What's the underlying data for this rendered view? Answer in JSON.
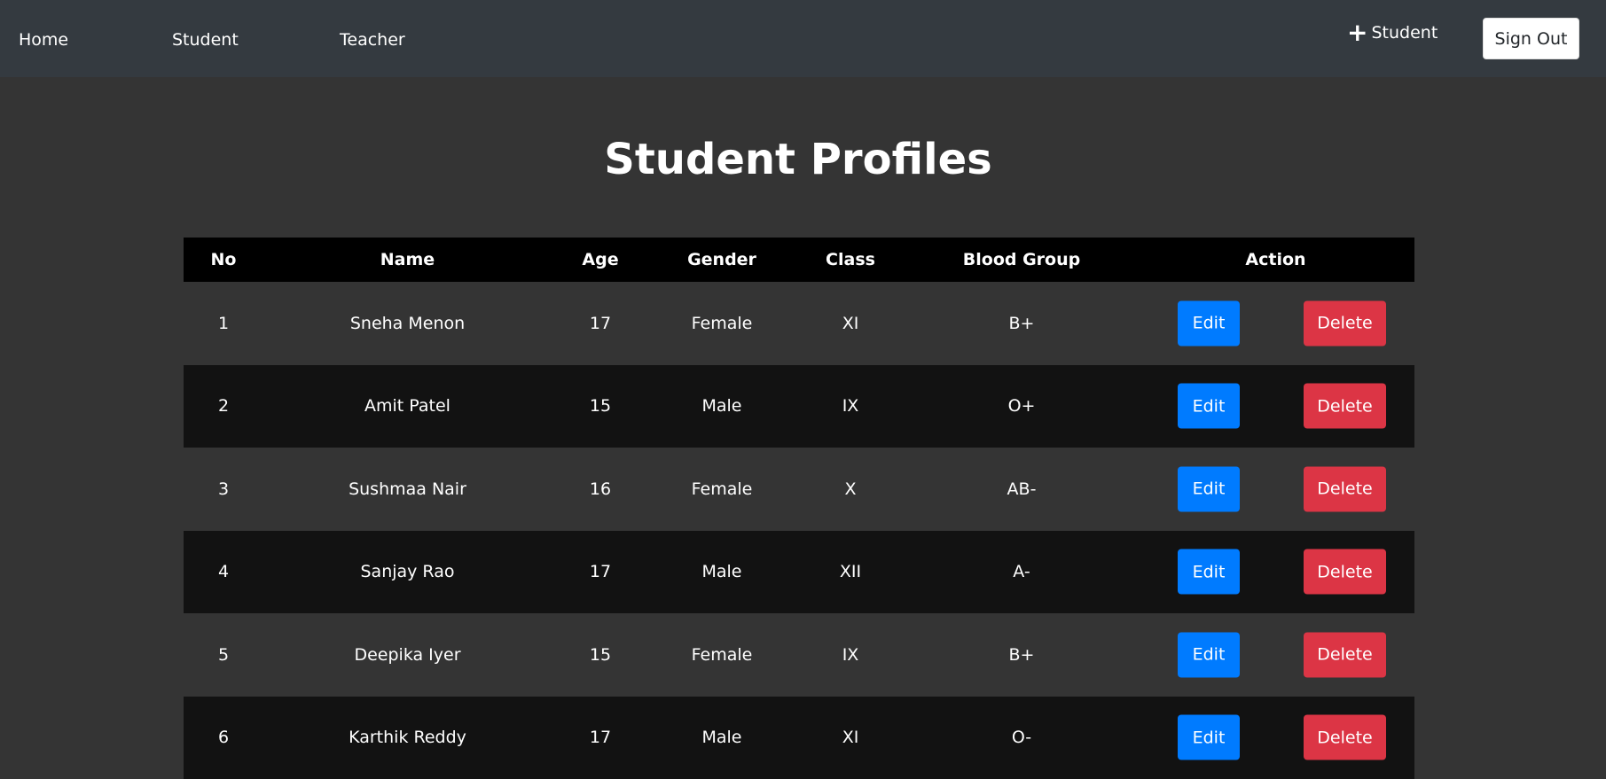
{
  "nav": {
    "home": "Home",
    "student": "Student",
    "teacher": "Teacher",
    "add_student_icon": "+",
    "add_student": "Student",
    "sign_out": "Sign Out"
  },
  "page": {
    "title": "Student Profiles"
  },
  "table": {
    "headers": [
      "No",
      "Name",
      "Age",
      "Gender",
      "Class",
      "Blood Group",
      "Action"
    ],
    "rows": [
      {
        "no": "1",
        "name": "Sneha Menon",
        "age": "17",
        "gender": "Female",
        "class": "XI",
        "blood": "B+"
      },
      {
        "no": "2",
        "name": "Amit Patel",
        "age": "15",
        "gender": "Male",
        "class": "IX",
        "blood": "O+"
      },
      {
        "no": "3",
        "name": "Sushmaa Nair",
        "age": "16",
        "gender": "Female",
        "class": "X",
        "blood": "AB-"
      },
      {
        "no": "4",
        "name": "Sanjay Rao",
        "age": "17",
        "gender": "Male",
        "class": "XII",
        "blood": "A-"
      },
      {
        "no": "5",
        "name": "Deepika Iyer",
        "age": "15",
        "gender": "Female",
        "class": "IX",
        "blood": "B+"
      },
      {
        "no": "6",
        "name": "Karthik Reddy",
        "age": "17",
        "gender": "Male",
        "class": "XI",
        "blood": "O-"
      }
    ],
    "edit_label": "Edit",
    "delete_label": "Delete"
  },
  "colors": {
    "navbar": "#343a40",
    "background": "#343434",
    "header_row": "#000000",
    "stripe": "#121212",
    "edit": "#007bff",
    "delete": "#dc3545"
  }
}
